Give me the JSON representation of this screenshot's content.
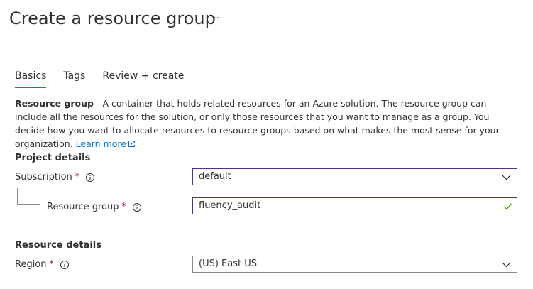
{
  "header": {
    "title": "Create a resource group",
    "more_label": "···"
  },
  "tabs": [
    {
      "label": "Basics",
      "active": true
    },
    {
      "label": "Tags",
      "active": false
    },
    {
      "label": "Review + create",
      "active": false
    }
  ],
  "description": {
    "term": "Resource group",
    "text": " - A container that holds related resources for an Azure solution. The resource group can include all the resources for the solution, or only those resources that you want to manage as a group. You decide how you want to allocate resources to resource groups based on what makes the most sense for your organization. ",
    "link": "Learn more"
  },
  "project_details": {
    "title": "Project details",
    "subscription": {
      "label": "Subscription",
      "required_mark": "*",
      "value": "default"
    },
    "resource_group": {
      "label": "Resource group",
      "required_mark": "*",
      "value": "fluency_audit"
    }
  },
  "resource_details": {
    "title": "Resource details",
    "region": {
      "label": "Region",
      "required_mark": "*",
      "value": "(US) East US"
    }
  },
  "colors": {
    "accent": "#0078d4",
    "required": "#a4262c",
    "focus_border": "#5c2d91",
    "valid_check": "#57a300"
  }
}
